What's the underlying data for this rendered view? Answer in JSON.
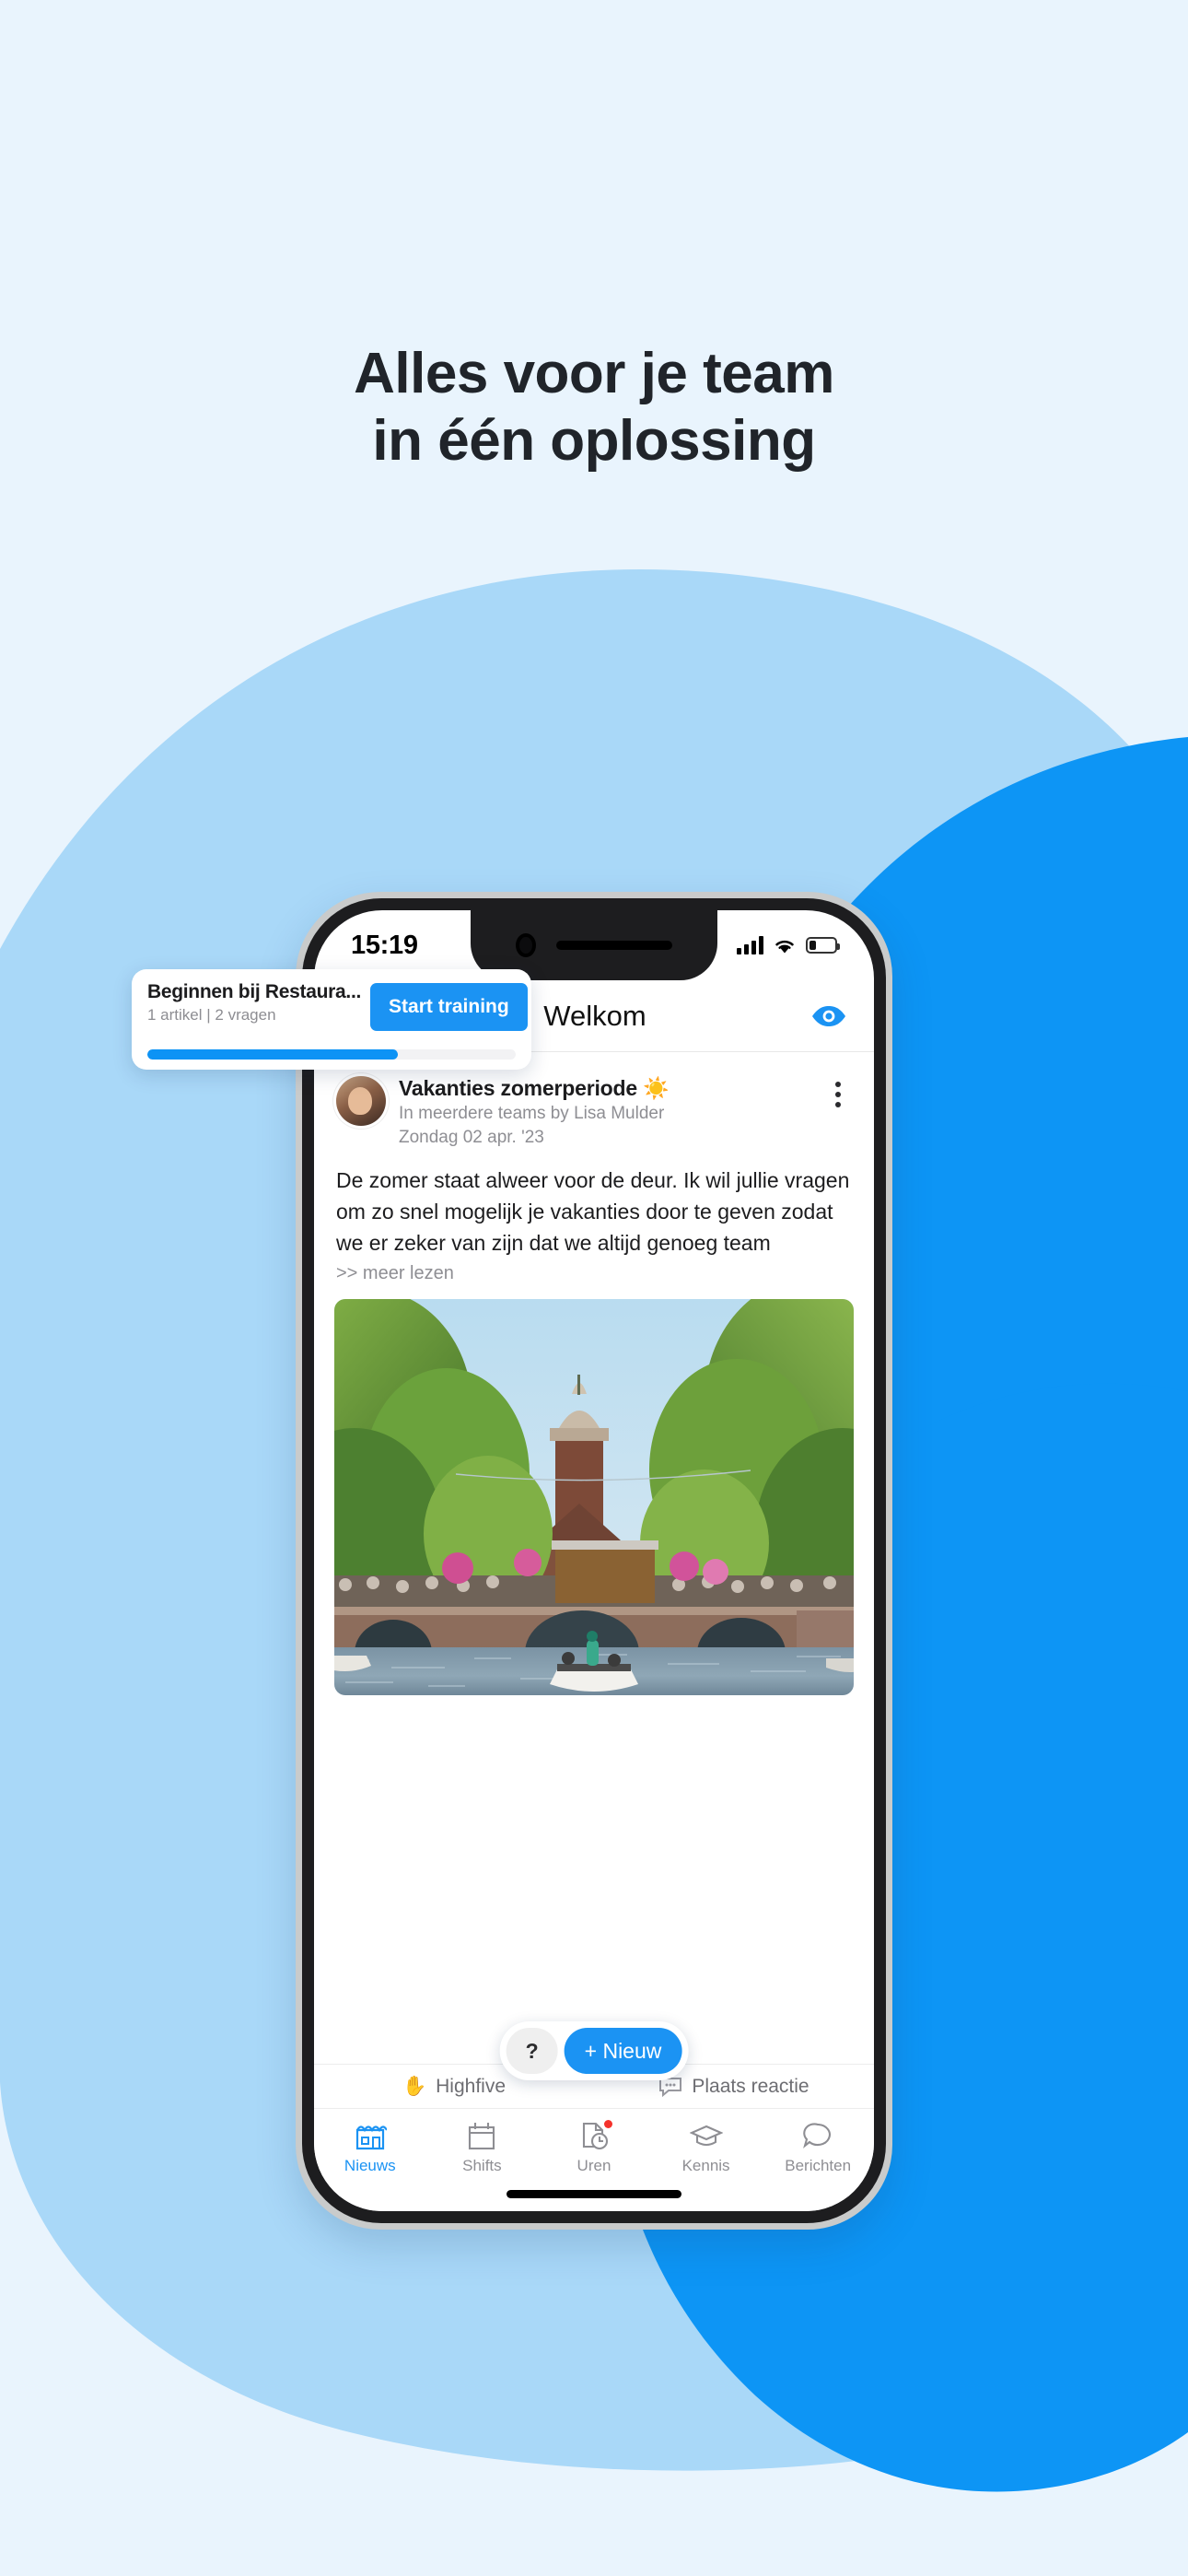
{
  "headline": {
    "line1": "Alles voor je team",
    "line2": "in één oplossing"
  },
  "colors": {
    "background": "#e9f4fd",
    "blob_light": "#a9d8f8",
    "blob_bright": "#0d95f5",
    "accent": "#1b93f3",
    "badge_red": "#f5322c",
    "text_dark": "#1c1c1e",
    "text_muted": "#8e8e93"
  },
  "phone": {
    "status_bar": {
      "time": "15:19",
      "signal_icon": "cellular-bars-icon",
      "wifi_icon": "wifi-icon",
      "battery_icon": "battery-icon",
      "battery_level": "26%"
    },
    "app_header": {
      "menu_icon": "hamburger-menu-icon",
      "title": "Welkom",
      "eye_icon": "eye-icon"
    },
    "training_card": {
      "title": "Beginnen bij Restaura...",
      "subtitle": "1 artikel | 2 vragen",
      "button_label": "Start training",
      "progress_percent": 68
    },
    "post": {
      "avatar": "user-avatar",
      "title": "Vakanties zomerperiode ☀️",
      "meta_line1": "In meerdere teams by Lisa Mulder",
      "meta_line2": "Zondag 02 apr. '23",
      "menu_icon": "kebab-menu-icon",
      "body": "De zomer staat alweer voor de deur. Ik wil jullie vragen om zo snel mogelijk je vakanties door te geven zodat we er zeker van zijn dat we altijd genoeg team",
      "read_more": ">> meer lezen",
      "image_alt": "amsterdam-canal-bridge-photo"
    },
    "fab": {
      "help_label": "?",
      "new_label": "+ Nieuw"
    },
    "reactions": [
      {
        "icon": "raised-hand-icon",
        "glyph": "✋",
        "label": "Highfive"
      },
      {
        "icon": "comment-icon",
        "glyph": "",
        "label": "Plaats reactie"
      }
    ],
    "tabs": [
      {
        "icon": "store-icon",
        "label": "Nieuws",
        "active": true,
        "badge": false
      },
      {
        "icon": "calendar-icon",
        "label": "Shifts",
        "active": false,
        "badge": false
      },
      {
        "icon": "timesheet-icon",
        "label": "Uren",
        "active": false,
        "badge": true
      },
      {
        "icon": "graduation-cap-icon",
        "label": "Kennis",
        "active": false,
        "badge": false
      },
      {
        "icon": "chat-bubble-icon",
        "label": "Berichten",
        "active": false,
        "badge": false
      }
    ]
  }
}
